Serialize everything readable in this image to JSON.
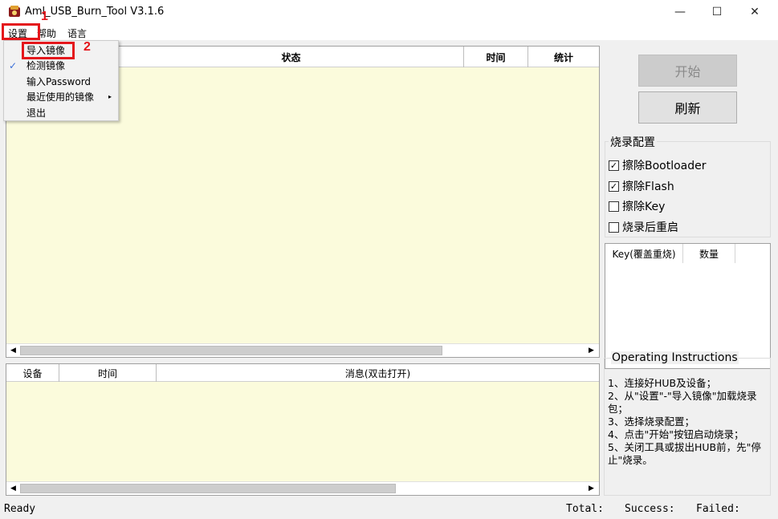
{
  "window": {
    "title": "Aml_USB_Burn_Tool V3.1.6",
    "controls": {
      "minimize": "—",
      "maximize": "☐",
      "close": "✕"
    }
  },
  "menubar": {
    "items": [
      "设置",
      "帮助",
      "语言"
    ]
  },
  "settings_menu": {
    "items": [
      {
        "label": "导入镜像",
        "checked": false,
        "submenu": false
      },
      {
        "label": "检测镜像",
        "checked": true,
        "submenu": false
      },
      {
        "label": "输入Password",
        "checked": false,
        "submenu": false
      },
      {
        "label": "最近使用的镜像",
        "checked": false,
        "submenu": true
      },
      {
        "label": "退出",
        "checked": false,
        "submenu": false
      }
    ],
    "check_glyph": "✓",
    "submenu_glyph": "▸"
  },
  "annotations": {
    "step1": "1",
    "step2": "2",
    "color": "#e4161b"
  },
  "upper_table": {
    "columns": [
      "",
      "状态",
      "时间",
      "统计"
    ]
  },
  "lower_table": {
    "columns": [
      "设备",
      "时间",
      "消息(双击打开)"
    ]
  },
  "scroll_arrows": {
    "left": "◀",
    "right": "▶"
  },
  "buttons": {
    "start": "开始",
    "refresh": "刷新"
  },
  "burn_config": {
    "title": "烧录配置",
    "options": [
      {
        "label": "擦除Bootloader",
        "checked": true
      },
      {
        "label": "擦除Flash",
        "checked": true
      },
      {
        "label": "擦除Key",
        "checked": false
      },
      {
        "label": "烧录后重启",
        "checked": false
      }
    ]
  },
  "key_table": {
    "columns": [
      "Key(覆盖重烧)",
      "数量"
    ]
  },
  "instructions": {
    "title": "Operating Instructions",
    "text": "1、连接好HUB及设备；\n2、从\"设置\"-\"导入镜像\"加载烧录包；\n3、选择烧录配置；\n4、点击\"开始\"按钮启动烧录；\n5、关闭工具或拔出HUB前，先\"停止\"烧录。"
  },
  "statusbar": {
    "status": "Ready",
    "total": "Total:",
    "success": "Success:",
    "failed": "Failed:"
  },
  "colors": {
    "list_background": "#fbfbdc",
    "window_background": "#f0f0f0",
    "annotation": "#e4161b"
  }
}
